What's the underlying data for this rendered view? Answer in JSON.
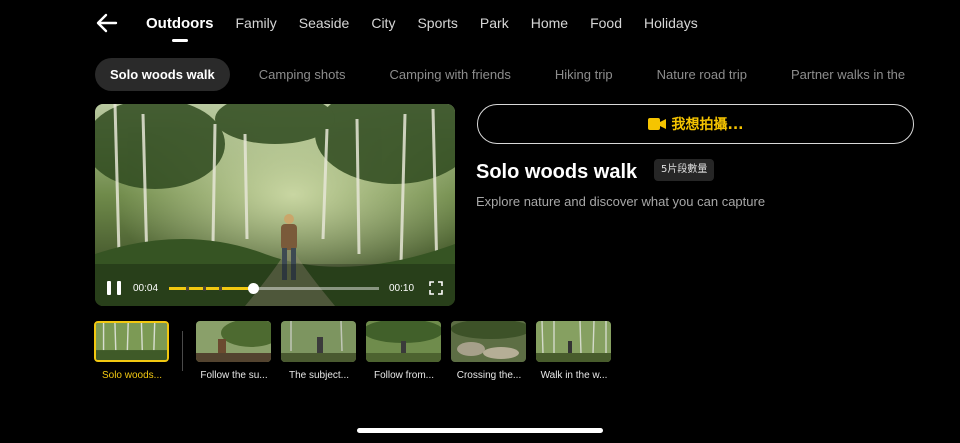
{
  "nav": {
    "back_icon": "arrow-left-icon",
    "categories": [
      {
        "label": "Outdoors",
        "active": true
      },
      {
        "label": "Family"
      },
      {
        "label": "Seaside"
      },
      {
        "label": "City"
      },
      {
        "label": "Sports"
      },
      {
        "label": "Park"
      },
      {
        "label": "Home"
      },
      {
        "label": "Food"
      },
      {
        "label": "Holidays"
      }
    ]
  },
  "chips": [
    {
      "label": "Solo woods walk",
      "active": true
    },
    {
      "label": "Camping shots"
    },
    {
      "label": "Camping with friends"
    },
    {
      "label": "Hiking trip"
    },
    {
      "label": "Nature road trip"
    },
    {
      "label": "Partner walks in the"
    }
  ],
  "player": {
    "current_time": "00:04",
    "duration": "00:10",
    "progress": 0.4,
    "segments": 5,
    "accent_color": "#f2c811"
  },
  "detail": {
    "shoot_button": "我想拍攝...",
    "shoot_icon": "video-camera-icon",
    "title": "Solo woods walk",
    "badge": "5片段數量",
    "description": "Explore nature and discover what you can capture"
  },
  "clips": [
    {
      "caption": "Solo woods...",
      "active": true
    },
    {
      "caption": "Follow the su..."
    },
    {
      "caption": "The subject..."
    },
    {
      "caption": "Follow from..."
    },
    {
      "caption": "Crossing the..."
    },
    {
      "caption": "Walk in the w..."
    }
  ]
}
